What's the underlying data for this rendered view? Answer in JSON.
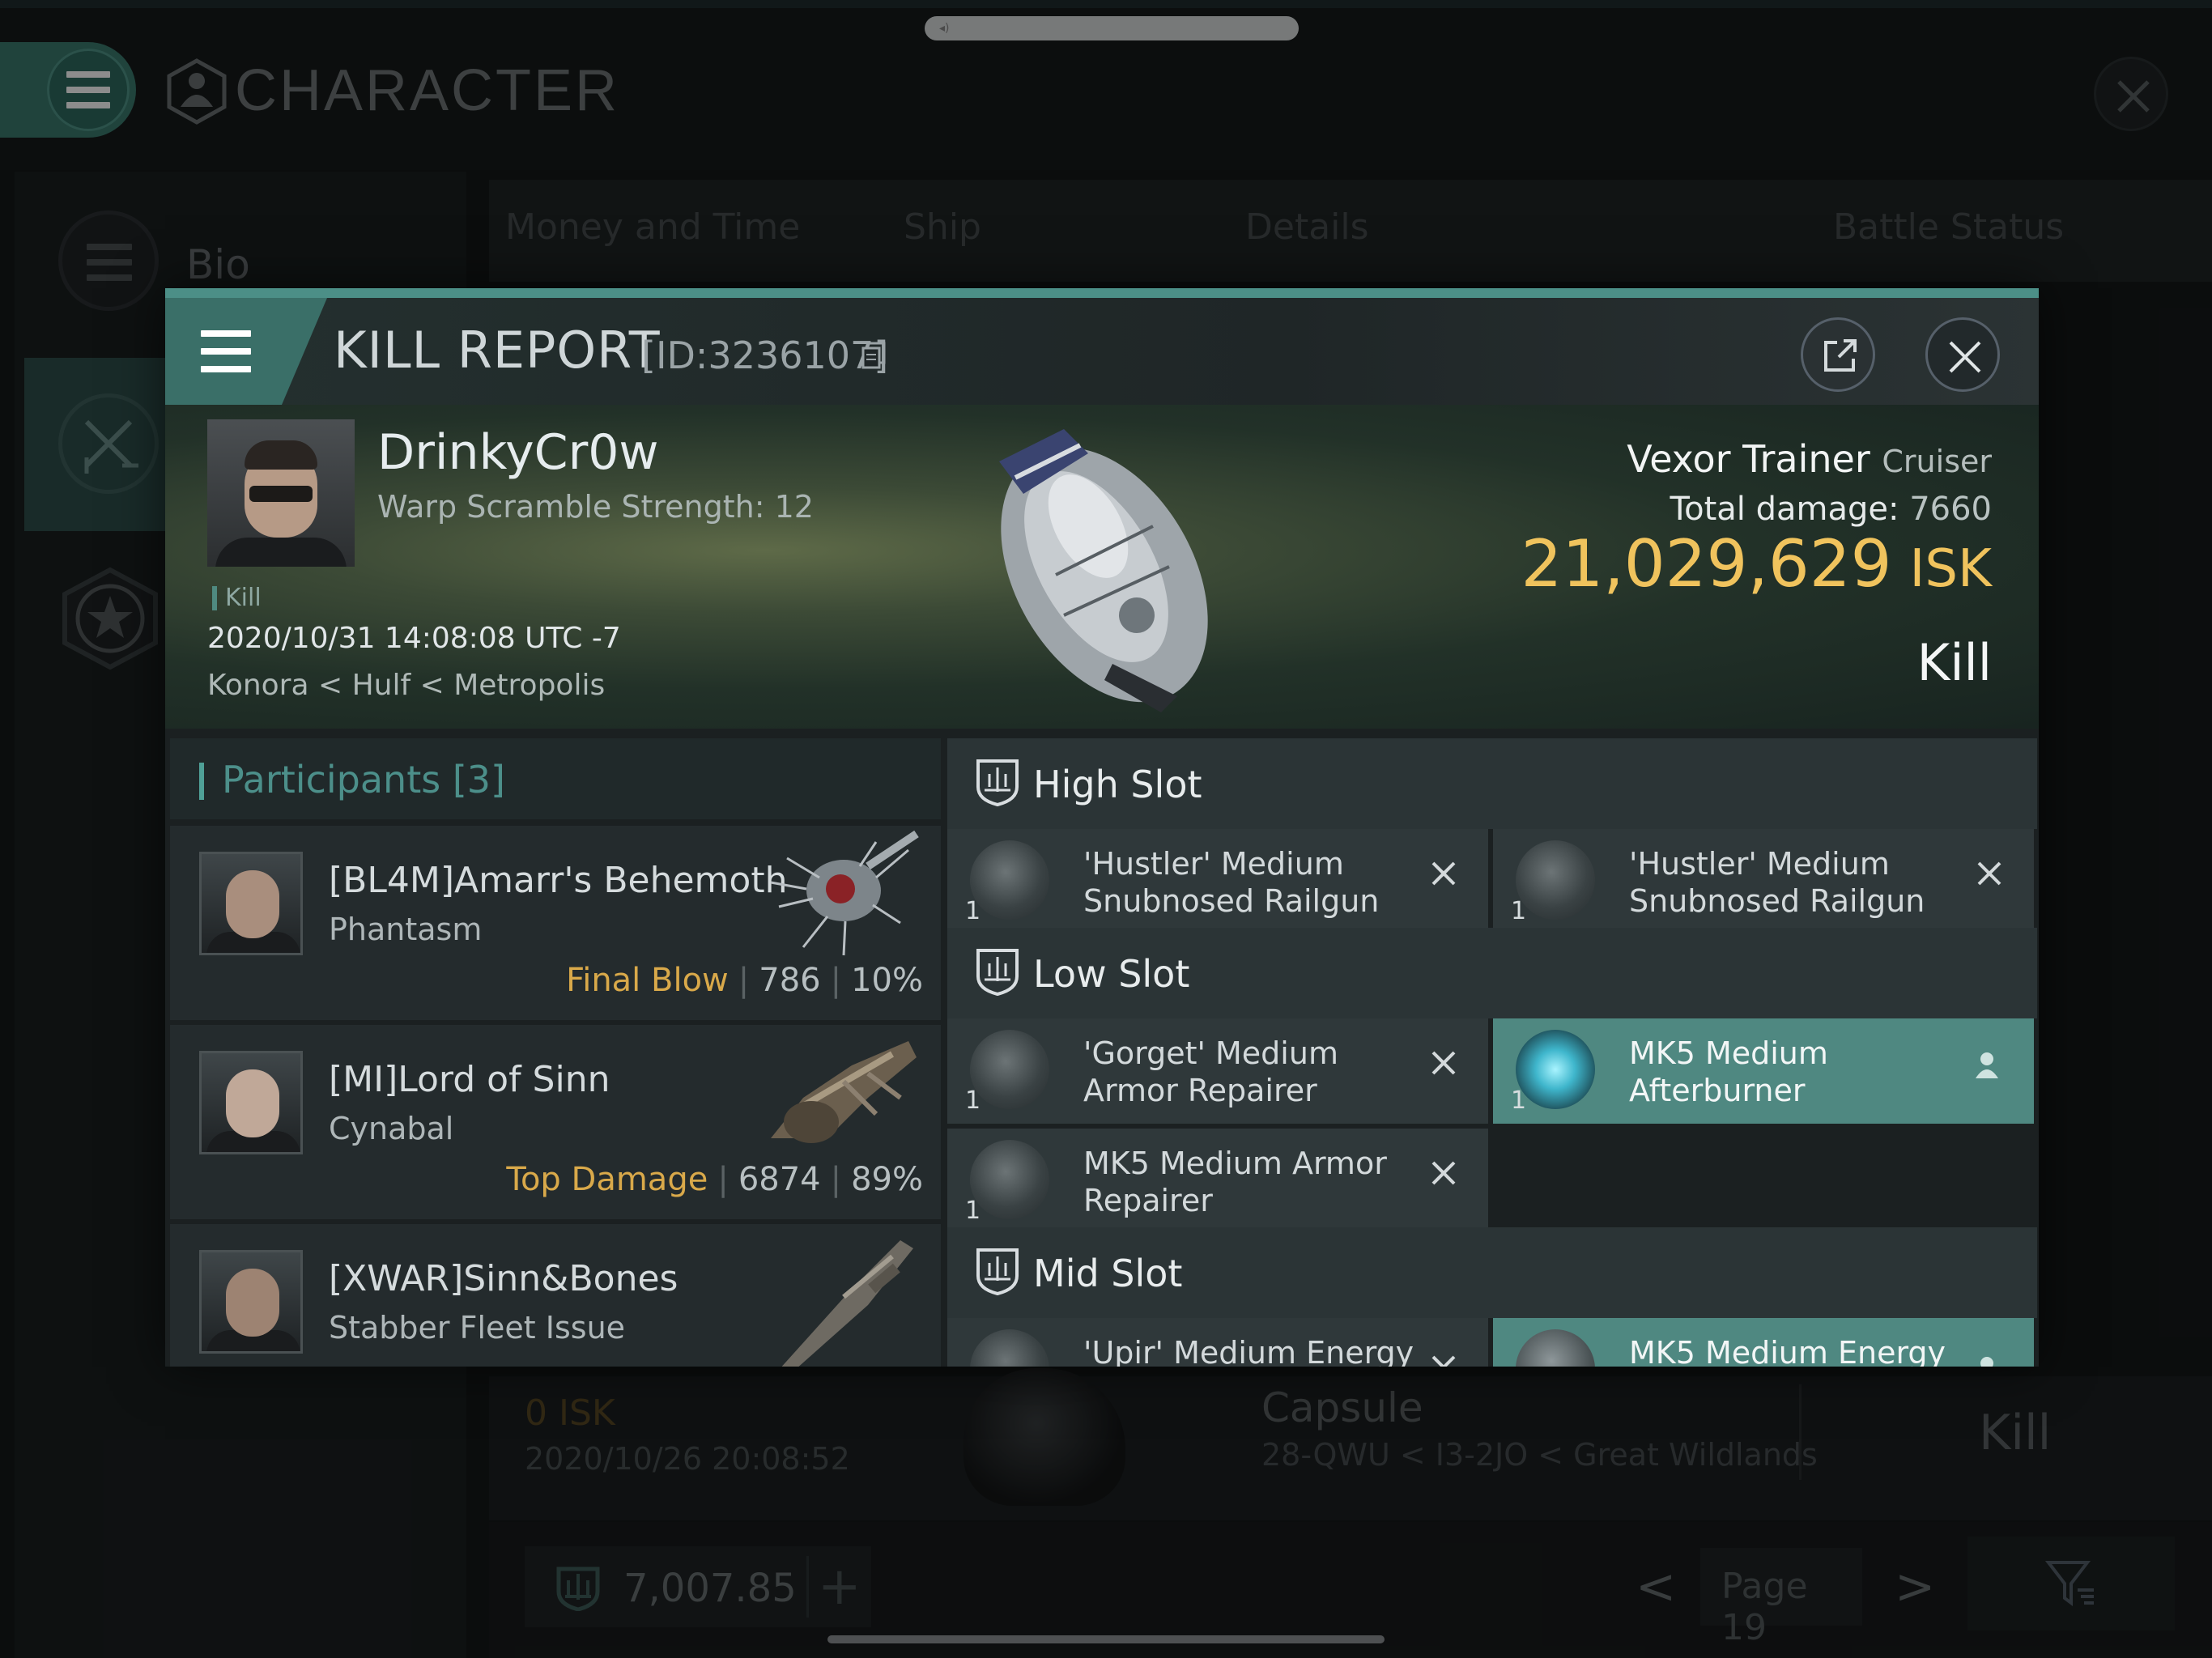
{
  "app": {
    "title": "CHARACTER",
    "grabber_glyph": "◂)"
  },
  "sidebar": {
    "items": [
      {
        "label": "Bio",
        "icon": "menu-icon"
      },
      {
        "label": "",
        "icon": "crossed-swords-icon"
      },
      {
        "label": "",
        "icon": "star-icon"
      }
    ]
  },
  "background_tabs": [
    "Money and Time",
    "Ship",
    "Details",
    "Battle Status"
  ],
  "background_row": {
    "isk": "0  ISK",
    "date": "2020/10/26  20:08:52",
    "ship": "Capsule",
    "location": "28-QWU < I3-2JO < Great Wildlands",
    "result": "Kill"
  },
  "bottom_bar": {
    "wallet": "7,007.85",
    "plus": "+",
    "prev": "<",
    "page": "Page 19",
    "next": ">"
  },
  "kill_report": {
    "title": "KILL REPORT",
    "id": "[ID:3236107]",
    "victim": {
      "name": "DrinkyCr0w",
      "warp_scramble": "Warp Scramble Strength: 12",
      "tag": "Kill",
      "datetime": "2020/10/31 14:08:08 UTC -7",
      "location": "Konora < Hulf < Metropolis"
    },
    "ship": {
      "name": "Vexor Trainer",
      "class": "Cruiser",
      "damage_label": "Total damage:",
      "damage": "7660",
      "isk_value": "21,029,629",
      "isk_unit": "ISK",
      "result": "Kill"
    },
    "participants": {
      "label": "Participants",
      "count": "[3]",
      "rows": [
        {
          "name": "[BL4M]Amarr's Behemoth",
          "ship": "Phantasm",
          "stat_label": "Final Blow",
          "damage": "786",
          "percent": "10%"
        },
        {
          "name": "[MI]Lord of Sinn",
          "ship": "Cynabal",
          "stat_label": "Top Damage",
          "damage": "6874",
          "percent": "89%"
        },
        {
          "name": "[XWAR]Sinn&Bones",
          "ship": "Stabber Fleet Issue",
          "stat_label": "",
          "damage": "",
          "percent": ""
        }
      ]
    },
    "slots": {
      "high": {
        "label": "High Slot",
        "modules": [
          {
            "qty": "1",
            "name": "'Hustler' Medium Snubnosed Railgun",
            "status": "destroyed"
          },
          {
            "qty": "1",
            "name": "'Hustler' Medium Snubnosed Railgun",
            "status": "destroyed"
          }
        ]
      },
      "low": {
        "label": "Low Slot",
        "modules": [
          {
            "qty": "1",
            "name": "'Gorget' Medium Armor Repairer",
            "status": "destroyed"
          },
          {
            "qty": "1",
            "name": "MK5 Medium Afterburner",
            "status": "dropped"
          },
          {
            "qty": "1",
            "name": "MK5 Medium Armor Repairer",
            "status": "destroyed"
          }
        ]
      },
      "mid": {
        "label": "Mid Slot",
        "modules": [
          {
            "qty": "",
            "name": "'Upir' Medium Energy",
            "status": "destroyed"
          },
          {
            "qty": "",
            "name": "MK5 Medium Energy",
            "status": "dropped"
          }
        ]
      }
    }
  },
  "colors": {
    "accent": "#4c8f87",
    "isk_gold": "#f0c35d",
    "stat_gold": "#d9a94a",
    "selected_module": "#4f8881"
  }
}
